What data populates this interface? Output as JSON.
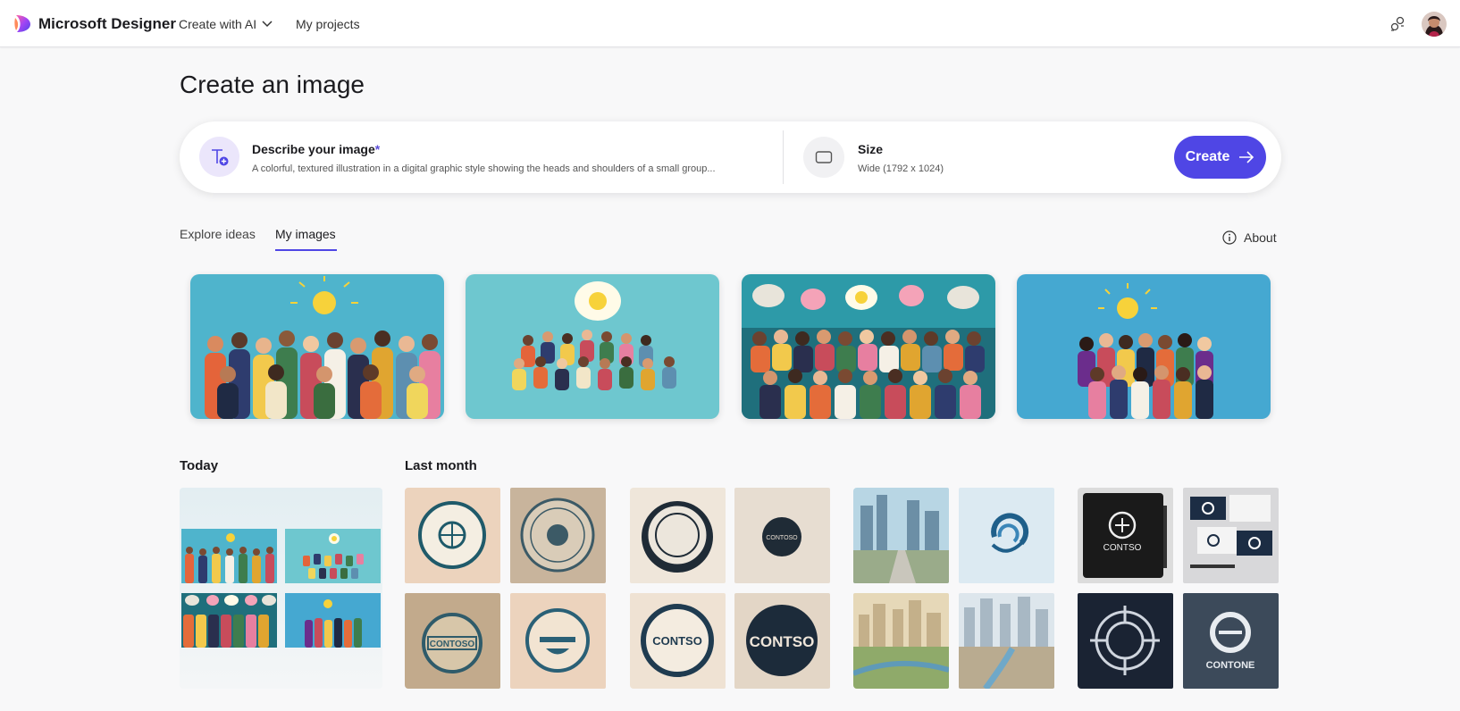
{
  "topbar": {
    "brand": "Microsoft Designer",
    "create_menu": "Create with AI",
    "projects": "My projects"
  },
  "page": {
    "title": "Create an image"
  },
  "prompt": {
    "label": "Describe your image",
    "required_mark": "*",
    "text": "A colorful, textured illustration in a digital graphic style showing the heads and shoulders of a small group..."
  },
  "size": {
    "label": "Size",
    "value": "Wide (1792 x 1024)"
  },
  "create_button": "Create",
  "tabs": {
    "explore": "Explore ideas",
    "my_images": "My images",
    "active": "My images"
  },
  "about": "About",
  "sections": {
    "today": "Today",
    "last_month": "Last month"
  },
  "colors": {
    "accent": "#4f46e5",
    "background": "#f8f8f9"
  },
  "icons": {
    "logo": "designer-logo-icon",
    "chevron": "chevron-down-icon",
    "share": "share-icon",
    "text_prompt": "text-prompt-icon",
    "size": "aspect-ratio-icon",
    "arrow": "arrow-right-icon",
    "info": "info-icon"
  },
  "logo_texts": {
    "contoso": "CONTSO",
    "contoso2": "CONTOSO",
    "contone": "CONTONE"
  }
}
